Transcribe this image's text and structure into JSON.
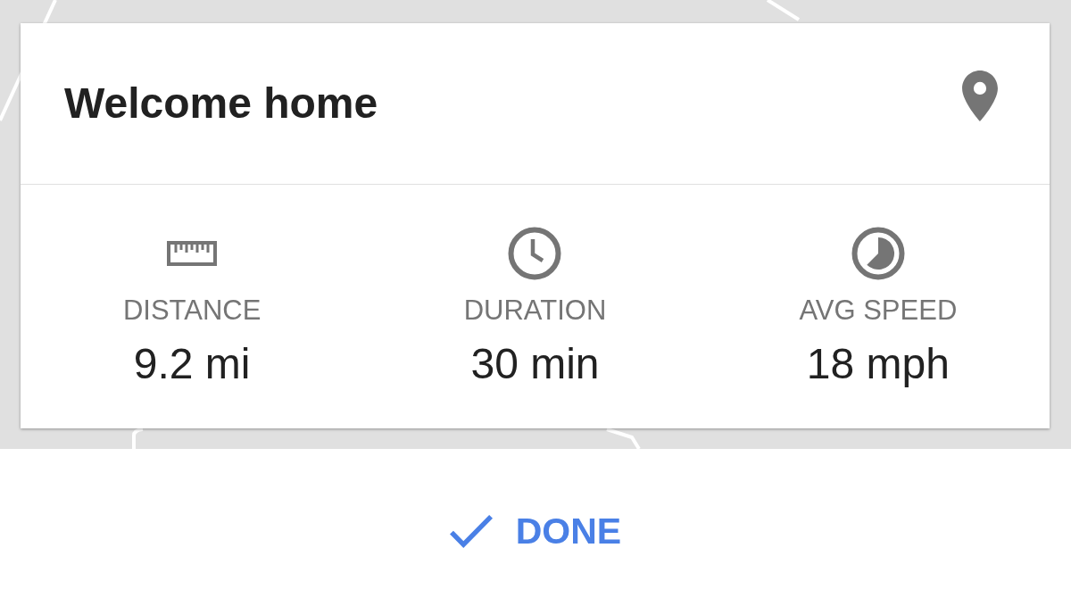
{
  "card": {
    "title": "Welcome home",
    "stats": [
      {
        "kind": "distance",
        "label": "DISTANCE",
        "value": "9.2 mi"
      },
      {
        "kind": "duration",
        "label": "DURATION",
        "value": "30 min"
      },
      {
        "kind": "speed",
        "label": "AVG SPEED",
        "value": "18 mph"
      }
    ]
  },
  "done_button": {
    "label": "DONE"
  }
}
